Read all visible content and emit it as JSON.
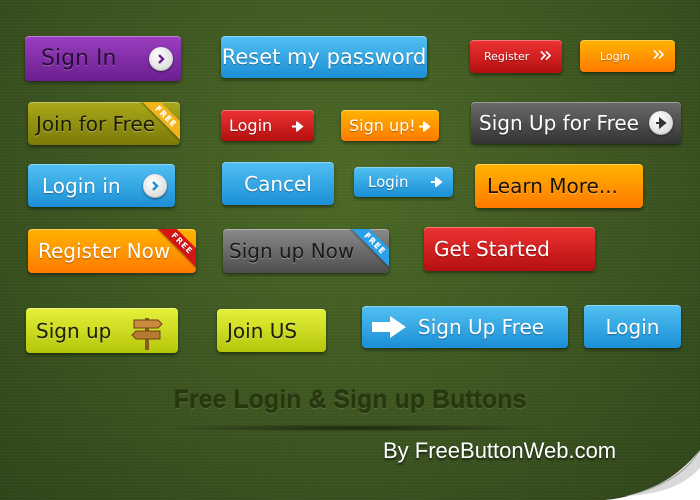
{
  "buttons": {
    "sign_in": "Sign In",
    "reset_password": "Reset my password",
    "register_small": "Register",
    "login_small_orange": "Login",
    "join_for_free": "Join for Free",
    "login_red": "Login",
    "sign_up_orange": "Sign up!",
    "sign_up_for_free": "Sign Up for Free",
    "login_in": "Login in",
    "cancel": "Cancel",
    "login_blue_small": "Login",
    "learn_more": "Learn More...",
    "register_now": "Register Now",
    "sign_up_now": "Sign up Now",
    "get_started": "Get Started",
    "sign_up_lime": "Sign up",
    "join_us": "Join US",
    "sign_up_free": "Sign Up Free",
    "login_large": "Login"
  },
  "ribbons": {
    "free_1": "FREE",
    "free_2": "FREE",
    "free_3": "FREE"
  },
  "heading": "Free  Login & Sign up Buttons",
  "credit": "By FreeButtonWeb.com",
  "colors": {
    "purple": "#7d2aa6",
    "sky": "#2aa0e6",
    "red": "#cc1a1a",
    "orange": "#ff9500",
    "olive": "#8f8d10",
    "gray": "#4a4a4a",
    "lime": "#cddc1a",
    "background": "#3f5a1f"
  },
  "icons": [
    "chevron-right-circle-icon",
    "double-chevron-icon",
    "arrow-right-icon",
    "signpost-icon",
    "page-curl-icon"
  ]
}
